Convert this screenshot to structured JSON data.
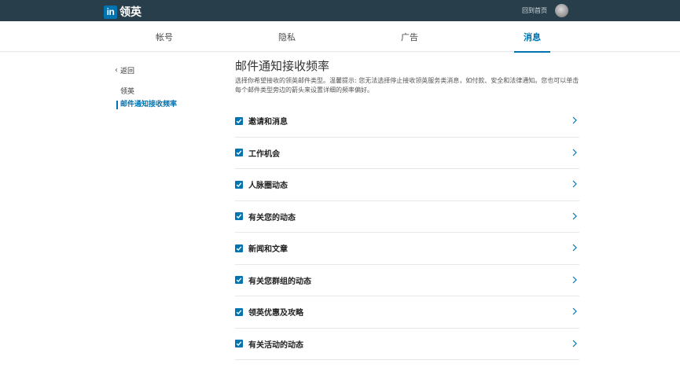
{
  "header": {
    "logo_mark": "in",
    "brand_name": "领英",
    "home_link": "回到首页"
  },
  "tabs": [
    {
      "label": "帐号",
      "active": false
    },
    {
      "label": "隐私",
      "active": false
    },
    {
      "label": "广告",
      "active": false
    },
    {
      "label": "消息",
      "active": true
    }
  ],
  "sidebar": {
    "back_label": "返回",
    "section_label": "领英",
    "active_item": "邮件通知接收频率"
  },
  "main": {
    "title": "邮件通知接收频率",
    "description": "选择你希望接收的领英邮件类型。温馨提示: 您无法选择停止接收领英服务类消息，如付款、安全和法律通知。您也可以单击每个邮件类型旁边的箭头来设置详细的频率偏好。",
    "items": [
      {
        "label": "邀请和消息",
        "checked": true
      },
      {
        "label": "工作机会",
        "checked": true
      },
      {
        "label": "人脉圈动态",
        "checked": true
      },
      {
        "label": "有关您的动态",
        "checked": true
      },
      {
        "label": "新闻和文章",
        "checked": true
      },
      {
        "label": "有关您群组的动态",
        "checked": true
      },
      {
        "label": "领英优惠及攻略",
        "checked": true
      },
      {
        "label": "有关活动的动态",
        "checked": true
      }
    ]
  },
  "colors": {
    "topbar": "#283e4a",
    "accent": "#0073b1"
  }
}
